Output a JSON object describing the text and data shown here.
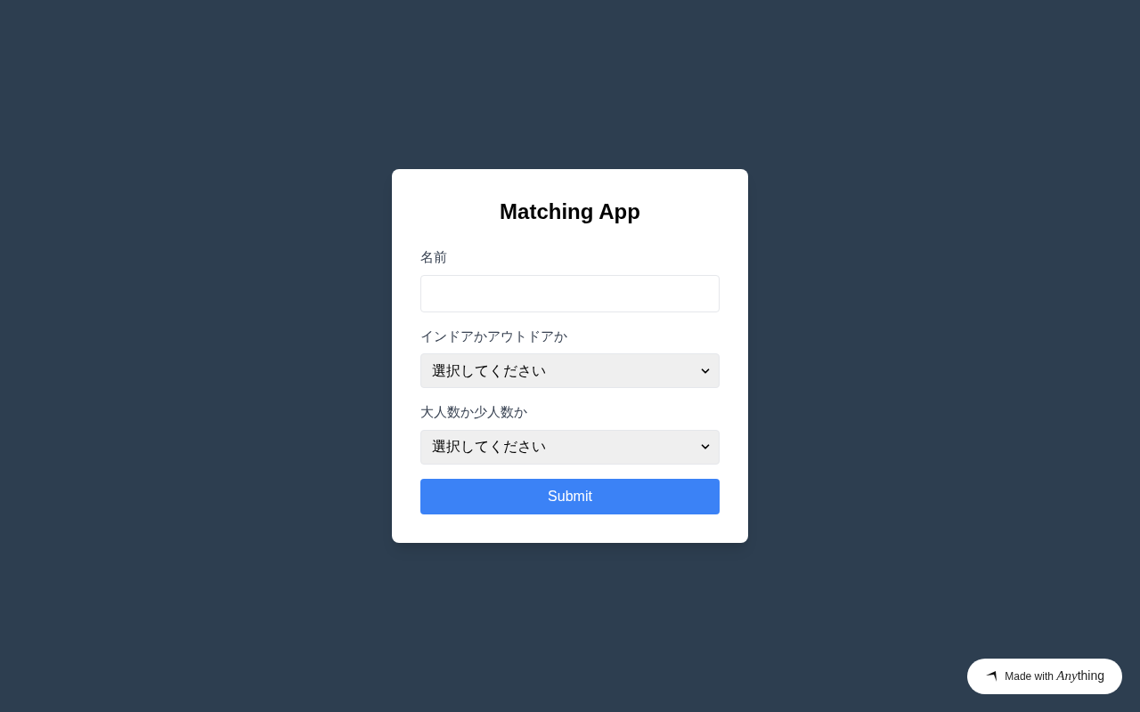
{
  "form": {
    "title": "Matching App",
    "fields": [
      {
        "kind": "text",
        "label": "名前"
      },
      {
        "kind": "select",
        "label": "インドアかアウトドアか",
        "value": "選択してください"
      },
      {
        "kind": "select",
        "label": "大人数か少人数か",
        "value": "選択してください"
      }
    ],
    "submit": "Submit"
  },
  "badge": {
    "text": "Made with",
    "brand_italic": "Any",
    "brand_rest": "thing"
  }
}
